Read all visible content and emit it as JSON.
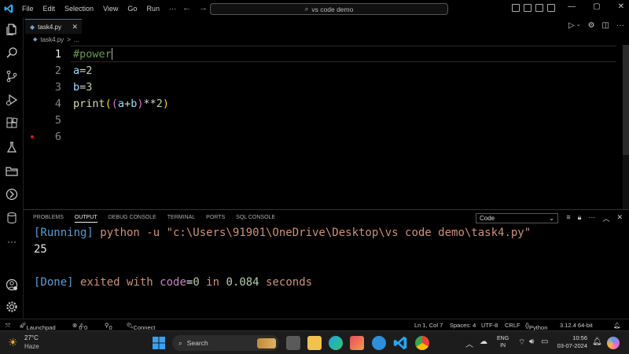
{
  "window": {
    "menu": [
      "File",
      "Edit",
      "Selection",
      "View",
      "Go",
      "Run",
      "···"
    ],
    "search_text": "vs code demo",
    "controls": [
      "—",
      "▢",
      "✕"
    ]
  },
  "tab": {
    "label": "task4.py",
    "close": "✕"
  },
  "breadcrumb": {
    "file": "task4.py",
    "sep": ">",
    "more": "..."
  },
  "editor": {
    "lines": [
      {
        "num": "1",
        "comment": "#power"
      },
      {
        "num": "2",
        "var": "a",
        "op": "=",
        "num_val": "2"
      },
      {
        "num": "3",
        "var": "b",
        "op": "=",
        "num_val": "3"
      },
      {
        "num": "4",
        "fn": "print",
        "p1o": "(",
        "p2o": "(",
        "a": "a",
        "plus": "+",
        "b": "b",
        "p2c": ")",
        "pow": "**",
        "n": "2",
        "p1c": ")"
      },
      {
        "num": "5"
      },
      {
        "num": "6"
      }
    ]
  },
  "panel": {
    "tabs": [
      "PROBLEMS",
      "OUTPUT",
      "DEBUG CONSOLE",
      "TERMINAL",
      "PORTS",
      "SQL CONSOLE"
    ],
    "select_value": "Code",
    "output": {
      "running_tag": "[Running]",
      "cmd": " python -u \"c:\\Users\\91901\\OneDrive\\Desktop\\vs code demo\\task4.py\"",
      "result": "25",
      "done_tag": "[Done]",
      "exited": " exited with ",
      "code_label": "code",
      "eq": "=",
      "code_val": "0",
      "in_word": " in ",
      "seconds_val": "0.084",
      "seconds_word": " seconds"
    }
  },
  "status": {
    "launchpad": "Launchpad",
    "errors": "0",
    "warnings": "0",
    "ports": "0",
    "connect": "Connect",
    "position": "Ln 1, Col 7",
    "spaces": "Spaces: 4",
    "encoding": "UTF-8",
    "eol": "CRLF",
    "language": "Python",
    "version": "3.12.4 64-bit"
  },
  "taskbar": {
    "weather_temp": "27°C",
    "weather_desc": "Haze",
    "search_label": "Search",
    "lang1": "ENG",
    "lang2": "IN",
    "time": "10:56",
    "date": "03-07-2024"
  }
}
